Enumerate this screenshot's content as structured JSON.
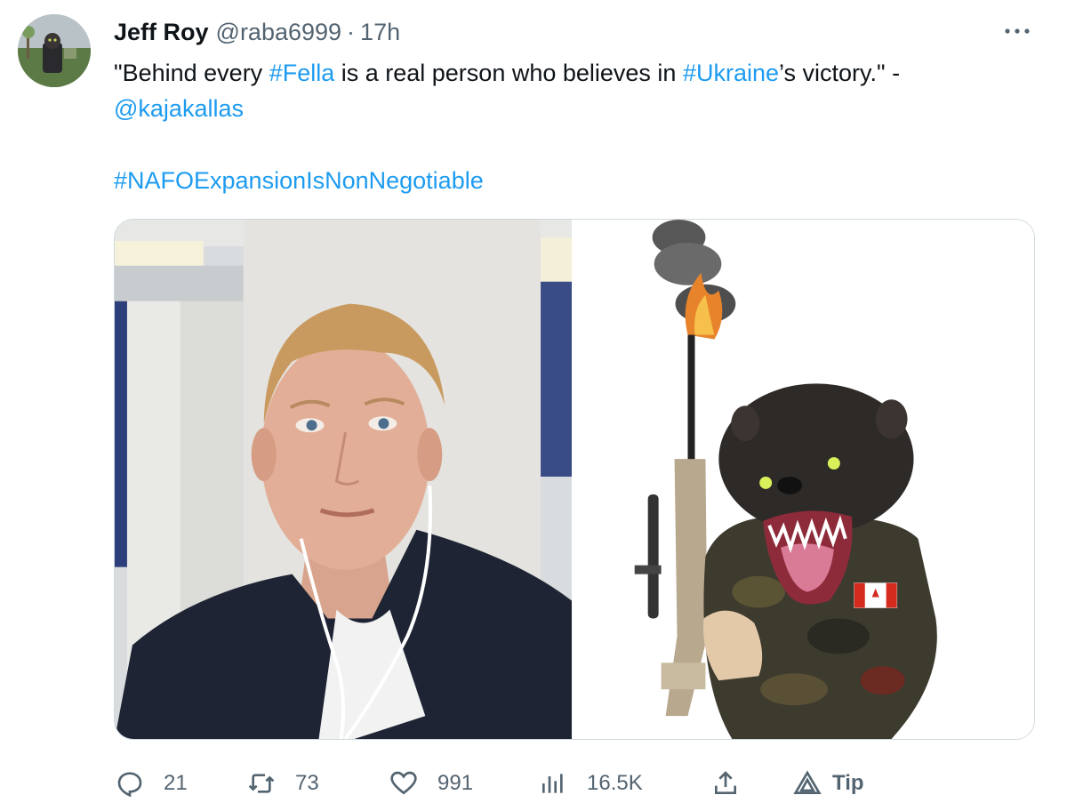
{
  "author": {
    "name": "Jeff Roy",
    "handle": "@raba6999",
    "separator": "·",
    "time": "17h"
  },
  "tweet": {
    "parts": [
      {
        "text": "\"Behind every ",
        "link": false
      },
      {
        "text": "#Fella",
        "link": true
      },
      {
        "text": " is a real person who believes in ",
        "link": true,
        "plain": true
      },
      {
        "text": "#Ukraine",
        "link": true
      },
      {
        "text": "’s victory.\" - ",
        "link": false
      },
      {
        "text": "@kajakallas",
        "link": true
      }
    ],
    "text_1": "\"Behind every ",
    "link_fella": "#Fella",
    "text_2": " is a real person who believes in ",
    "link_ukraine": "#Ukraine",
    "text_3": "’s victory.\" - ",
    "link_mention": "@kajakallas",
    "hashtag": "#NAFOExpansionIsNonNegotiable"
  },
  "actions": {
    "replies": "21",
    "retweets": "73",
    "likes": "991",
    "views": "16.5K",
    "tip_label": "Tip"
  },
  "icons": {
    "more": "more-icon",
    "reply": "reply-icon",
    "retweet": "retweet-icon",
    "like": "heart-icon",
    "views": "analytics-icon",
    "share": "share-icon",
    "tip": "tip-icon"
  },
  "colors": {
    "link": "#1d9bf0",
    "secondary": "#536471",
    "text": "#0f1419"
  }
}
